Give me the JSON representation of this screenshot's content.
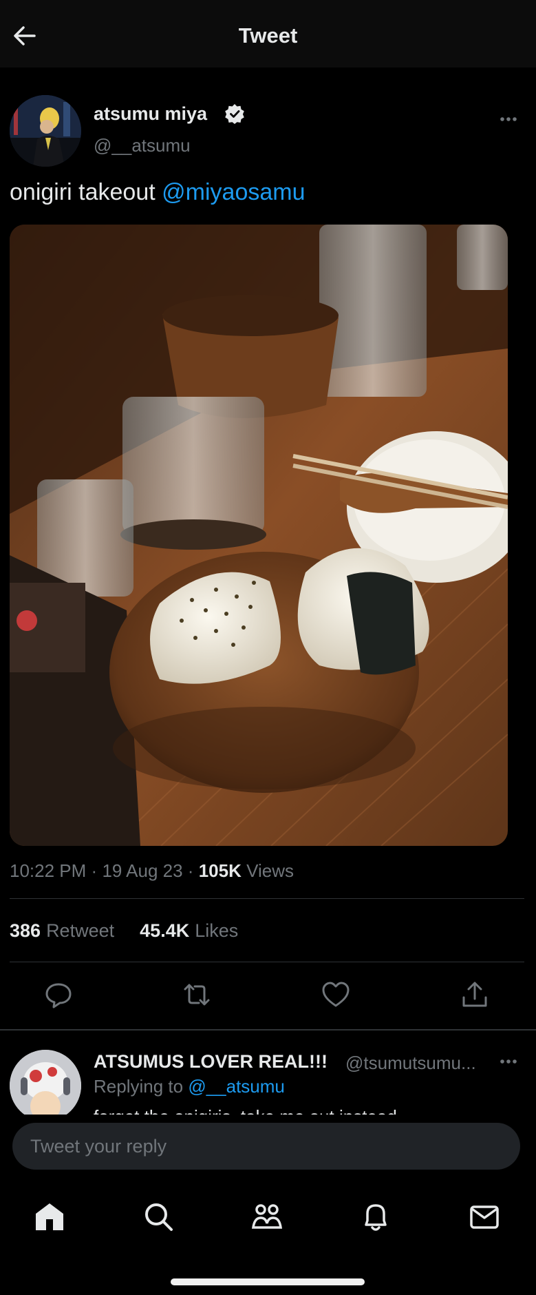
{
  "header": {
    "title": "Tweet",
    "back_icon": "arrow-left-icon"
  },
  "tweet": {
    "author_name": "atsumu miya",
    "verified_icon": "verified-badge-icon",
    "author_handle": "@__atsumu",
    "text": "onigiri takeout",
    "mention": "@miyaosamu",
    "time": "10:22 PM",
    "date": "19 Aug 23",
    "separator": "·",
    "views_count": "105K",
    "views_label": "Views",
    "retweet_count": "386",
    "retweet_label": "Retweet",
    "likes_count": "45.4K",
    "likes_label": "Likes",
    "image_icon": "onigiri-photo"
  },
  "actions": [
    "reply-icon",
    "retweet-icon",
    "like-icon",
    "share-icon"
  ],
  "reply": {
    "author_name": "ATSUMUS LOVER REAL!!!",
    "author_handle": "@tsumutsumu...",
    "replying_to_label": "Replying to",
    "replying_to_handle": "@__atsumu",
    "snippet": "forget the onigiris, take me out instead"
  },
  "composer": {
    "placeholder": "Tweet your reply"
  },
  "bottom_nav": [
    "home-icon",
    "search-icon",
    "communities-icon",
    "notifications-icon",
    "messages-icon"
  ],
  "colors": {
    "background": "#000000",
    "accent": "#1d9bf0",
    "text": "#e7e9ea",
    "muted": "#71767b"
  }
}
